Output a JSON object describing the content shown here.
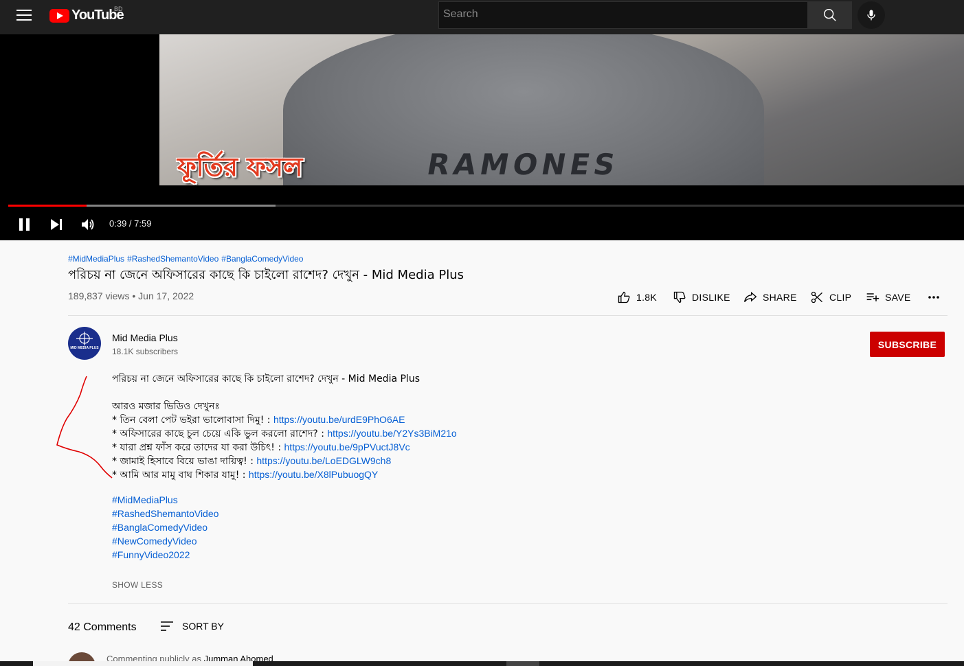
{
  "header": {
    "logo_text": "YouTube",
    "country_code": "BD",
    "search_placeholder": "Search"
  },
  "player": {
    "time": "0:39 / 7:59",
    "progress_fraction": 0.082,
    "buffered_fraction": 0.28,
    "caption_text": "ফূর্তির ফসল",
    "shirt_text": "RAMONES"
  },
  "video": {
    "hashtags": [
      "#MidMediaPlus",
      "#RashedShemantoVideo",
      "#BanglaComedyVideo"
    ],
    "title": "পরিচয় না জেনে অফিসারের কাছে কি চাইলো রাশেদ? দেখুন - Mid Media Plus",
    "view_info": "189,837 views • Jun 17, 2022"
  },
  "actions": {
    "like": "1.8K",
    "dislike": "DISLIKE",
    "share": "SHARE",
    "clip": "CLIP",
    "save": "SAVE"
  },
  "channel": {
    "name": "Mid Media Plus",
    "subscribers": "18.1K subscribers",
    "avatar_text": "MID MEDIA PLUS",
    "subscribe_label": "SUBSCRIBE"
  },
  "description": {
    "line1": "পরিচয় না জেনে অফিসারের কাছে কি চাইলো রাশেদ? দেখুন - Mid Media Plus",
    "more_heading": "আরও মজার ভিডিও দেখুনঃ",
    "links": [
      {
        "text": "*  তিন বেলা পেট ভইরা ভালোবাসা দিমু! : ",
        "url": "https://youtu.be/urdE9PhO6AE"
      },
      {
        "text": "* অফিসারের কাছে চুল চেয়ে একি ভুল করলো রাশেদ? : ",
        "url": "https://youtu.be/Y2Ys3BiM21o"
      },
      {
        "text": "* যারা প্রশ্ন ফাঁস করে তাদের যা করা উচিৎ! : ",
        "url": "https://youtu.be/9pPVuctJ8Vc"
      },
      {
        "text": "* জামাই হিসাবে বিয়ে ভাঙা দায়িত্ব! : ",
        "url": "https://youtu.be/LoEDGLW9ch8"
      },
      {
        "text": "* আমি আর মামু বাঘ শিকার যামু! : ",
        "url": "https://youtu.be/X8lPubuogQY"
      }
    ],
    "tags": [
      "#MidMediaPlus",
      "#RashedShemantoVideo",
      "#BanglaComedyVideo",
      "#NewComedyVideo",
      "#FunnyVideo2022"
    ],
    "show_less": "SHOW LESS"
  },
  "comments": {
    "count": "42 Comments",
    "sort_label": "SORT BY",
    "commenting_prefix": "Commenting publicly as ",
    "commenting_name": "Jumman Ahomed"
  },
  "colors": {
    "youtube_red": "#ff0000",
    "subscribe_red": "#cc0000",
    "link_blue": "#065fd4",
    "annotation_red": "#e00000"
  }
}
